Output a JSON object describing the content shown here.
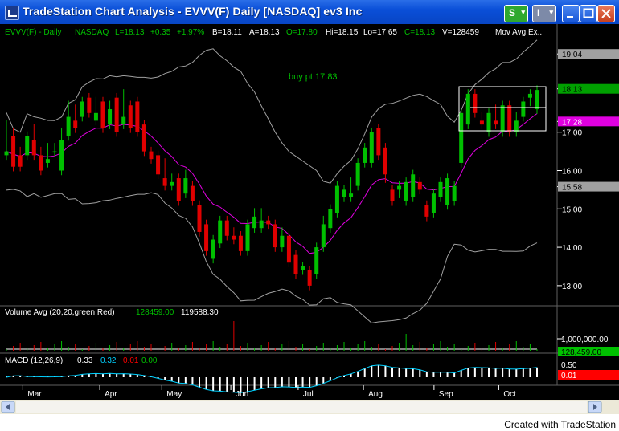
{
  "window": {
    "title": "TradeStation Chart Analysis - EVVV(F)  Daily  [NASDAQ] ev3 Inc",
    "s_button": "S",
    "i_button": "I"
  },
  "chart_header": {
    "symbol": "EVVV(F) - Daily",
    "exchange": "NASDAQ",
    "last": "L=18.13",
    "change": "+0.35",
    "change_pct": "+1.97%",
    "bid": "B=18.11",
    "ask": "A=18.13",
    "open": "O=17.80",
    "high": "Hi=18.15",
    "low": "Lo=17.65",
    "close": "C=18.13",
    "volume": "V=128459",
    "study": "Mov Avg Ex..."
  },
  "annotation": "buy pt 17.83",
  "price_axis": {
    "ticks": [
      "19.04",
      "18.13",
      "17.28",
      "17.00",
      "16.00",
      "15.58",
      "15.00",
      "14.00",
      "13.00"
    ],
    "markers": [
      {
        "label": "19.04",
        "color": "#a0a0a0"
      },
      {
        "label": "18.13",
        "color": "#00a000"
      },
      {
        "label": "17.28",
        "color": "#e000e0"
      },
      {
        "label": "15.58",
        "color": "#a0a0a0"
      }
    ]
  },
  "volume_panel": {
    "label": "Volume Avg  (20,20,green,Red)",
    "value1": "128459.00",
    "value2": "119588.30",
    "axis_label": "1,000,000.00",
    "marker": "128,459.00"
  },
  "macd_panel": {
    "label": "MACD  (12,26,9)",
    "v1": "0.33",
    "v2": "0.32",
    "v3": "0.01",
    "v4": "0.00",
    "axis_label": "0.50",
    "marker": "0.01"
  },
  "months": [
    "Mar",
    "Apr",
    "May",
    "Jun",
    "Jul",
    "Aug",
    "Sep",
    "Oct"
  ],
  "footer": "Created with TradeStation",
  "colors": {
    "up": "#00c000",
    "down": "#e00000",
    "ma": "#e000e0",
    "bands": "#a0a0a0",
    "header_green": "#00c000"
  },
  "chart_data": {
    "type": "candlestick",
    "symbol": "EVVV(F)",
    "ylim": [
      12.6,
      19.4
    ],
    "ohlc": [
      [
        16.4,
        17.2,
        16.5
      ],
      [
        16.9,
        17.0,
        16.1
      ],
      [
        16.4,
        16.5,
        16.1
      ],
      [
        16.4,
        16.7,
        16.9
      ],
      [
        16.8,
        17.1,
        16.4
      ],
      [
        16.4,
        16.5,
        16.0
      ],
      [
        16.2,
        16.6,
        16.3
      ],
      [
        16.5,
        16.6,
        16.5
      ],
      [
        16.0,
        17.0,
        16.8
      ],
      [
        16.9,
        17.7,
        17.4
      ],
      [
        17.3,
        17.6,
        17.1
      ],
      [
        17.4,
        17.8,
        17.8
      ],
      [
        17.9,
        17.9,
        17.5
      ],
      [
        17.3,
        17.8,
        17.5
      ],
      [
        17.8,
        17.8,
        17.1
      ],
      [
        17.2,
        17.7,
        17.6
      ],
      [
        17.9,
        17.9,
        17.0
      ],
      [
        17.2,
        18.0,
        17.4
      ],
      [
        17.7,
        17.7,
        17.1
      ],
      [
        17.8,
        17.6,
        17.0
      ],
      [
        17.2,
        16.9,
        16.5
      ],
      [
        16.5,
        16.4,
        16.3
      ],
      [
        16.4,
        16.2,
        15.9
      ],
      [
        15.8,
        16.2,
        15.6
      ],
      [
        15.6,
        15.8,
        15.7
      ],
      [
        15.8,
        15.6,
        15.2
      ],
      [
        15.4,
        15.9,
        15.8
      ],
      [
        15.6,
        15.6,
        15.2
      ],
      [
        15.1,
        14.9,
        14.4
      ],
      [
        14.6,
        14.1,
        13.9
      ],
      [
        13.7,
        14.2,
        14.2
      ],
      [
        14.1,
        14.5,
        14.7
      ],
      [
        14.7,
        14.5,
        14.3
      ],
      [
        14.3,
        14.4,
        14.2
      ],
      [
        14.3,
        14.1,
        13.9
      ],
      [
        13.9,
        14.3,
        14.6
      ],
      [
        14.5,
        14.9,
        14.8
      ],
      [
        14.5,
        14.9,
        14.7
      ],
      [
        14.7,
        14.7,
        14.6
      ],
      [
        14.6,
        14.4,
        14.0
      ],
      [
        14.0,
        14.4,
        14.3
      ],
      [
        14.3,
        13.8,
        13.6
      ],
      [
        13.8,
        13.4,
        13.3
      ],
      [
        13.4,
        13.5,
        13.5
      ],
      [
        13.4,
        13.2,
        13.0
      ],
      [
        13.3,
        13.6,
        14.0
      ],
      [
        14.0,
        14.7,
        14.6
      ],
      [
        14.5,
        15.0,
        15.0
      ],
      [
        14.9,
        15.5,
        15.6
      ],
      [
        15.3,
        15.4,
        15.5
      ],
      [
        15.3,
        15.7,
        15.4
      ],
      [
        15.6,
        16.0,
        16.2
      ],
      [
        16.2,
        16.5,
        16.6
      ],
      [
        16.2,
        16.6,
        17.0
      ],
      [
        17.1,
        17.0,
        16.4
      ],
      [
        16.6,
        15.8,
        15.9
      ],
      [
        15.5,
        15.3,
        15.2
      ],
      [
        15.5,
        15.4,
        15.6
      ],
      [
        15.2,
        15.3,
        15.7
      ],
      [
        15.3,
        15.5,
        15.9
      ],
      [
        15.7,
        15.6,
        15.5
      ],
      [
        15.1,
        15.0,
        14.8
      ],
      [
        14.9,
        15.2,
        15.4
      ],
      [
        15.3,
        15.6,
        15.7
      ],
      [
        15.1,
        15.5,
        15.8
      ],
      [
        15.2,
        15.4,
        15.6
      ],
      [
        16.2,
        16.8,
        17.5
      ],
      [
        17.2,
        17.8,
        18.0
      ],
      [
        18.0,
        17.6,
        17.5
      ],
      [
        17.3,
        17.4,
        17.2
      ],
      [
        17.0,
        17.3,
        17.5
      ],
      [
        17.3,
        17.6,
        17.2
      ],
      [
        17.0,
        17.6,
        17.7
      ],
      [
        17.7,
        17.5,
        17.0
      ],
      [
        17.0,
        17.4,
        17.3
      ],
      [
        17.4,
        17.6,
        17.8
      ],
      [
        17.9,
        17.8,
        18.0
      ],
      [
        17.6,
        17.8,
        18.1
      ]
    ],
    "legend": [
      "EVVV(F) - Daily",
      "Mov Avg Ex..."
    ]
  }
}
